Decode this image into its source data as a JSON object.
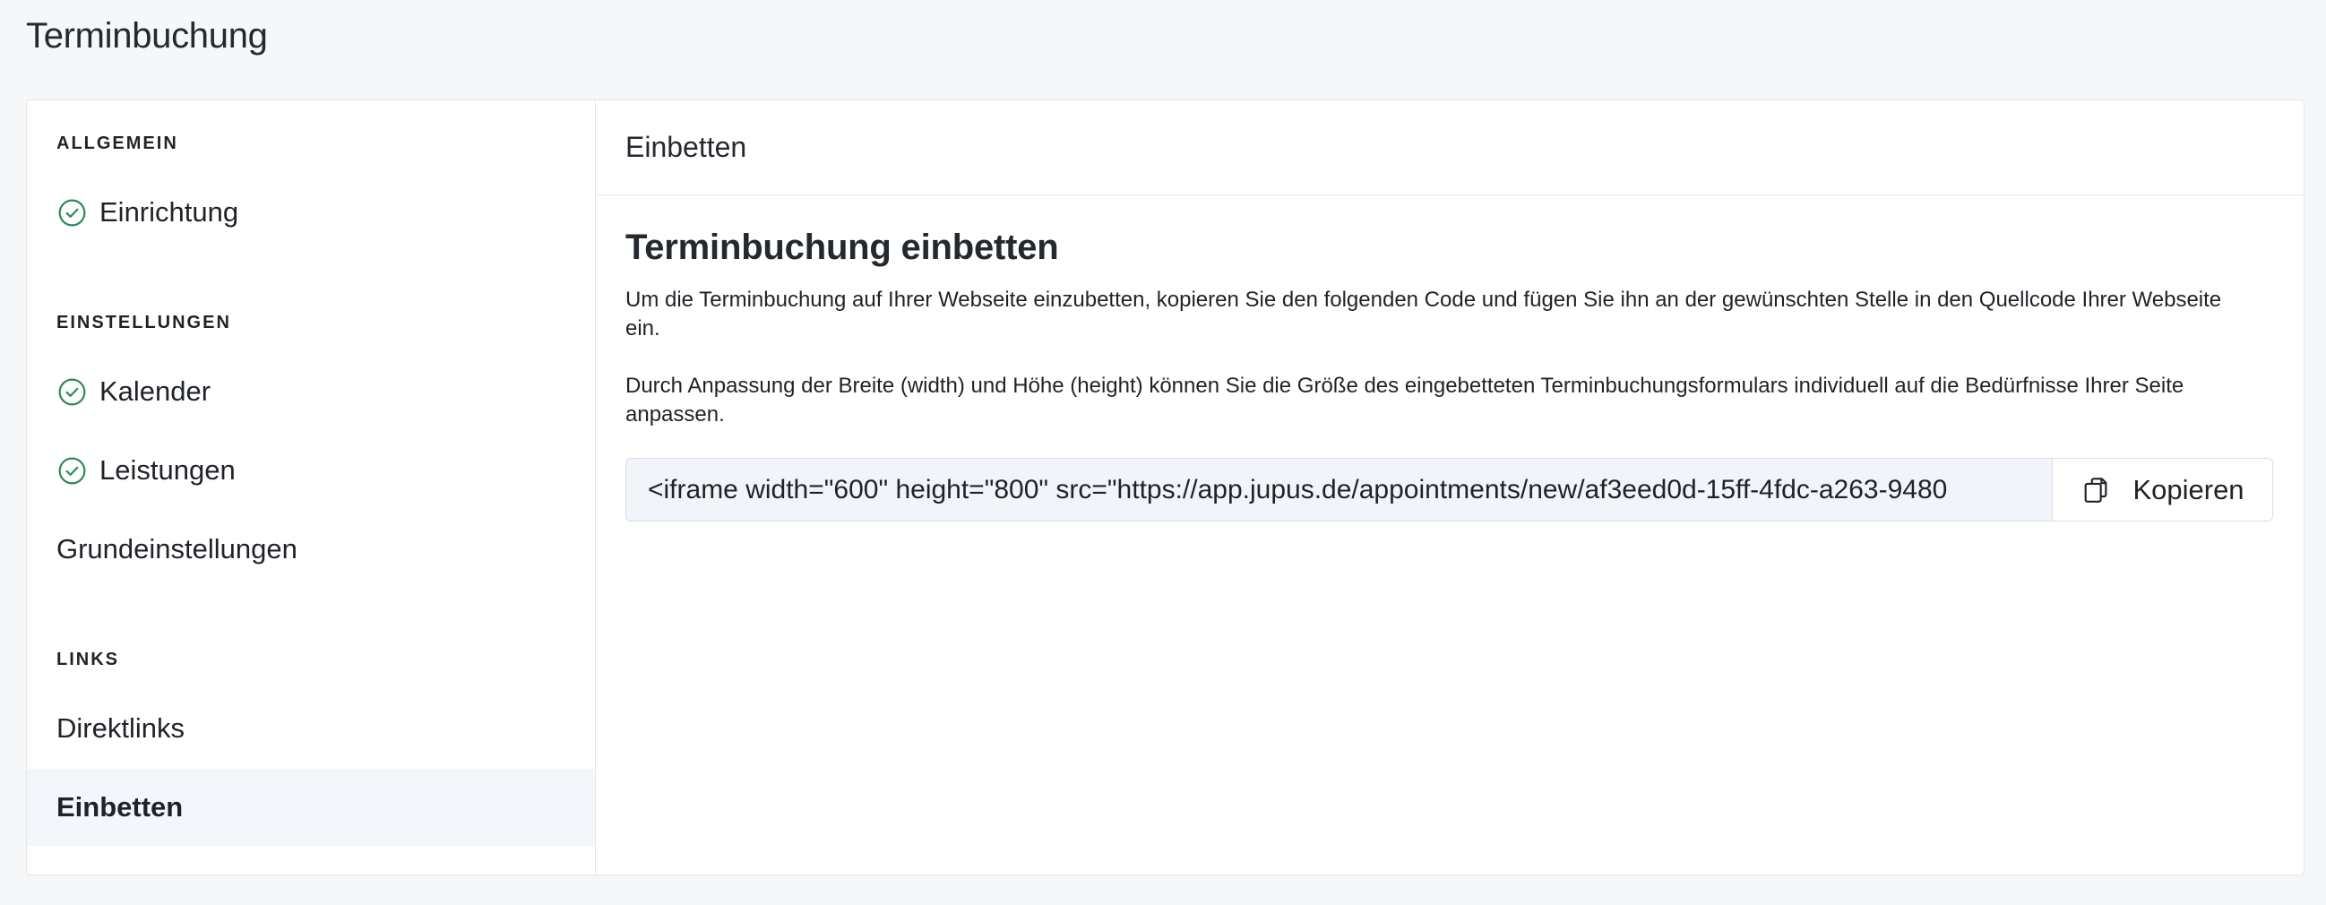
{
  "page": {
    "title": "Terminbuchung"
  },
  "sidebar": {
    "sections": {
      "general": "ALLGEMEIN",
      "settings": "EINSTELLUNGEN",
      "links": "LINKS"
    },
    "items": {
      "setup": "Einrichtung",
      "calendar": "Kalender",
      "services": "Leistungen",
      "basic_settings": "Grundeinstellungen",
      "direct_links": "Direktlinks",
      "embed": "Einbetten"
    }
  },
  "main": {
    "header": "Einbetten",
    "heading": "Terminbuchung einbetten",
    "paragraph1": "Um die Terminbuchung auf Ihrer Webseite einzubetten, kopieren Sie den folgenden Code und fügen Sie ihn an der gewünschten Stelle in den Quellcode Ihrer Webseite ein.",
    "paragraph2": "Durch Anpassung der Breite (width) und Höhe (height) können Sie die Größe des eingebetteten Terminbuchungsformulars individuell auf die Bedürfnisse Ihrer Seite anpassen.",
    "embed_code": "<iframe width=\"600\" height=\"800\" src=\"https://app.jupus.de/appointments/new/af3eed0d-15ff-4fdc-a263-9480",
    "copy_label": "Kopieren"
  },
  "colors": {
    "check_green": "#2e8a5a",
    "active_bg": "#f3f6fa",
    "input_bg": "#f1f4f8"
  },
  "icons": {
    "check": "check-circle-icon",
    "copy": "copy-icon"
  }
}
